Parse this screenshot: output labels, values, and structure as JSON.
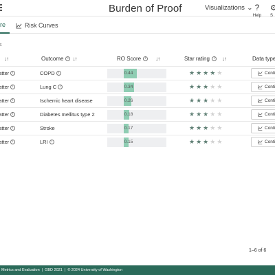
{
  "header": {
    "title": "Burden of Proof",
    "viz_label": "Visualizations",
    "help_label": "Help",
    "settings_label": "S"
  },
  "tabs": {
    "active_label": "re",
    "risk_label": "Risk Curves"
  },
  "section_label": "s",
  "table": {
    "headers": {
      "risk_sort": "↓↑",
      "outcome": "Outcome",
      "ro_score": "RO Score",
      "star_rating": "Star rating",
      "data_type": "Data type"
    },
    "rows": [
      {
        "risk": "matter",
        "outcome": "COPD",
        "ro": "0.44",
        "ro_value": 0.44,
        "stars": 4,
        "dtype": "Conti"
      },
      {
        "risk": "matter",
        "outcome": "Lung C",
        "ro": "0.34",
        "ro_value": 0.34,
        "stars": 3,
        "dtype": "Conti"
      },
      {
        "risk": "matter",
        "outcome": "Ischemic heart disease",
        "ro": "0.26",
        "ro_value": 0.26,
        "stars": 3,
        "dtype": "Conti"
      },
      {
        "risk": "matter",
        "outcome": "Diabetes mellitus type 2",
        "ro": "0.18",
        "ro_value": 0.18,
        "stars": 3,
        "dtype": "Conti"
      },
      {
        "risk": "matter",
        "outcome": "Stroke",
        "ro": "0.17",
        "ro_value": 0.17,
        "stars": 3,
        "dtype": "Conti"
      },
      {
        "risk": "matter",
        "outcome": "LRI",
        "ro": "0.15",
        "ro_value": 0.15,
        "stars": 3,
        "dtype": "Conti"
      }
    ],
    "star_max": 5
  },
  "pager": {
    "text": "1–6 of 6"
  },
  "footer": {
    "items": [
      "Metrics and Evaluation",
      "|",
      "GBD 2021",
      "|",
      "© 2024 University of Washington"
    ]
  },
  "colors": {
    "accent": "#2b6b5a",
    "bar_fill": "#8fcdb3",
    "star_on": "#5f7f74",
    "star_off": "#d2d2d2"
  },
  "icons": {
    "viz_chevron": "chevron-down-icon",
    "help": "question-icon",
    "risk_tab": "line-chart-icon",
    "dtype": "line-chart-icon"
  }
}
